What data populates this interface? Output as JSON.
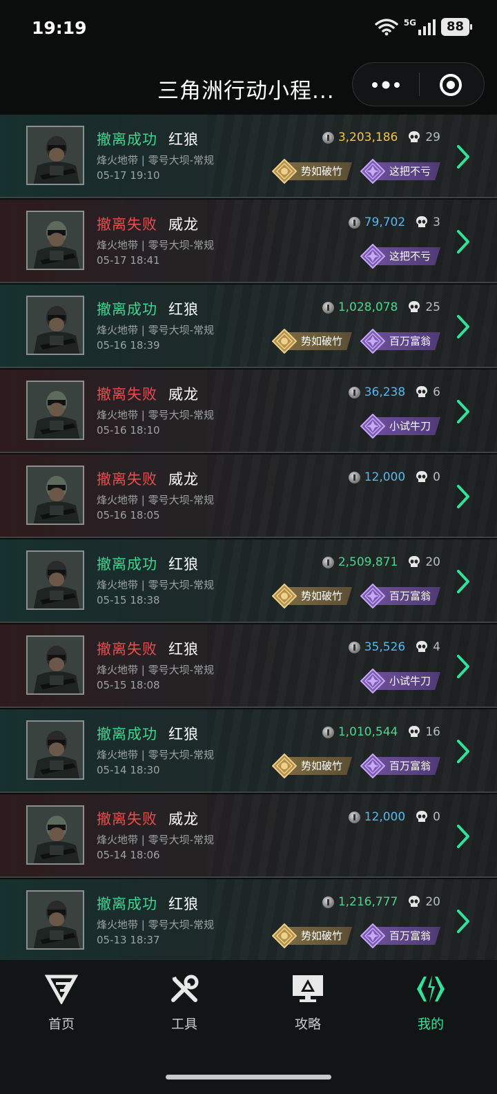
{
  "status_bar": {
    "time": "19:19",
    "network": "5G",
    "battery": "88"
  },
  "header": {
    "title": "三角洲行动小程..."
  },
  "icons": {
    "wifi": "wifi-icon",
    "signal": "signal-icon",
    "more": "more-dots-icon",
    "close": "close-circle-icon",
    "coin": "coin-icon",
    "skull": "skull-icon",
    "chevron": "chevron-right-icon"
  },
  "colors": {
    "success": "#3fd690",
    "fail": "#ec4c4c",
    "gold_value": "#f2c646",
    "green_value": "#49d78f",
    "blue_value": "#58b8f0",
    "active_tab": "#2fe39a"
  },
  "matches": [
    {
      "result": "撤离成功",
      "result_type": "success",
      "hero": "红狼",
      "mode": "烽火地带 | 零号大坝-常规",
      "time": "05-17 19:10",
      "value": "3,203,186",
      "value_color": "gold",
      "kills": "29",
      "badges": [
        {
          "label": "势如破竹",
          "type": "gold"
        },
        {
          "label": "这把不亏",
          "type": "purple"
        }
      ]
    },
    {
      "result": "撤离失败",
      "result_type": "fail",
      "hero": "威龙",
      "mode": "烽火地带 | 零号大坝-常规",
      "time": "05-17 18:41",
      "value": "79,702",
      "value_color": "blue",
      "kills": "3",
      "badges": [
        {
          "label": "这把不亏",
          "type": "purple"
        }
      ]
    },
    {
      "result": "撤离成功",
      "result_type": "success",
      "hero": "红狼",
      "mode": "烽火地带 | 零号大坝-常规",
      "time": "05-16 18:39",
      "value": "1,028,078",
      "value_color": "green",
      "kills": "25",
      "badges": [
        {
          "label": "势如破竹",
          "type": "gold"
        },
        {
          "label": "百万富翁",
          "type": "purple"
        }
      ]
    },
    {
      "result": "撤离失败",
      "result_type": "fail",
      "hero": "威龙",
      "mode": "烽火地带 | 零号大坝-常规",
      "time": "05-16 18:10",
      "value": "36,238",
      "value_color": "blue",
      "kills": "6",
      "badges": [
        {
          "label": "小试牛刀",
          "type": "purple"
        }
      ]
    },
    {
      "result": "撤离失败",
      "result_type": "fail",
      "hero": "威龙",
      "mode": "烽火地带 | 零号大坝-常规",
      "time": "05-16 18:05",
      "value": "12,000",
      "value_color": "blue",
      "kills": "0",
      "badges": []
    },
    {
      "result": "撤离成功",
      "result_type": "success",
      "hero": "红狼",
      "mode": "烽火地带 | 零号大坝-常规",
      "time": "05-15 18:38",
      "value": "2,509,871",
      "value_color": "green",
      "kills": "20",
      "badges": [
        {
          "label": "势如破竹",
          "type": "gold"
        },
        {
          "label": "百万富翁",
          "type": "purple"
        }
      ]
    },
    {
      "result": "撤离失败",
      "result_type": "fail",
      "hero": "红狼",
      "mode": "烽火地带 | 零号大坝-常规",
      "time": "05-15 18:08",
      "value": "35,526",
      "value_color": "blue",
      "kills": "4",
      "badges": [
        {
          "label": "小试牛刀",
          "type": "purple"
        }
      ]
    },
    {
      "result": "撤离成功",
      "result_type": "success",
      "hero": "红狼",
      "mode": "烽火地带 | 零号大坝-常规",
      "time": "05-14 18:30",
      "value": "1,010,544",
      "value_color": "green",
      "kills": "16",
      "badges": [
        {
          "label": "势如破竹",
          "type": "gold"
        },
        {
          "label": "百万富翁",
          "type": "purple"
        }
      ]
    },
    {
      "result": "撤离失败",
      "result_type": "fail",
      "hero": "威龙",
      "mode": "烽火地带 | 零号大坝-常规",
      "time": "05-14 18:06",
      "value": "12,000",
      "value_color": "blue",
      "kills": "0",
      "badges": []
    },
    {
      "result": "撤离成功",
      "result_type": "success",
      "hero": "红狼",
      "mode": "烽火地带 | 零号大坝-常规",
      "time": "05-13 18:37",
      "value": "1,216,777",
      "value_color": "green",
      "kills": "20",
      "badges": [
        {
          "label": "势如破竹",
          "type": "gold"
        },
        {
          "label": "百万富翁",
          "type": "purple"
        }
      ]
    }
  ],
  "tabbar": {
    "tabs": [
      {
        "label": "首页",
        "icon": "home-logo-icon",
        "active": false
      },
      {
        "label": "工具",
        "icon": "tools-icon",
        "active": false
      },
      {
        "label": "攻略",
        "icon": "guide-monitor-icon",
        "active": false
      },
      {
        "label": "我的",
        "icon": "profile-logo-icon",
        "active": true
      }
    ]
  }
}
